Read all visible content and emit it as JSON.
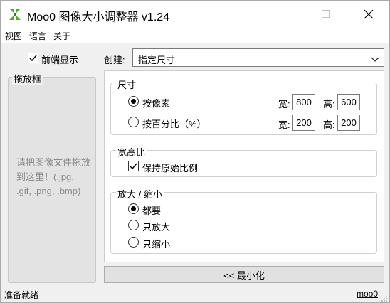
{
  "window": {
    "title": "Moo0 图像大小调整器 v1.24"
  },
  "menu": {
    "items": [
      {
        "label": "视图"
      },
      {
        "label": "语言"
      },
      {
        "label": "关于"
      }
    ]
  },
  "left": {
    "always_on_top_label": "前端显示",
    "always_on_top_checked": true,
    "drop_group_title": "拖放框",
    "drop_text": "请把图像文件拖放到这里！(.jpg, .gif, .png, .bmp)"
  },
  "create": {
    "label": "创建:",
    "selected": "指定尺寸"
  },
  "size_group": {
    "title": "尺寸",
    "by_pixel_label": "按像素",
    "by_pixel_checked": true,
    "by_percent_label": "按百分比（%）",
    "by_percent_checked": false,
    "width_label": "宽:",
    "height_label": "高:",
    "pixel_width": "800",
    "pixel_height": "600",
    "percent_width": "200",
    "percent_height": "200"
  },
  "aspect_group": {
    "title": "宽高比",
    "keep_ratio_label": "保持原始比例",
    "keep_ratio_checked": true
  },
  "scale_group": {
    "title": "放大 / 缩小",
    "options": [
      {
        "label": "都要",
        "checked": true
      },
      {
        "label": "只放大",
        "checked": false
      },
      {
        "label": "只缩小",
        "checked": false
      }
    ]
  },
  "minimize_button": "<< 最小化",
  "status": {
    "text": "准备就绪",
    "link": "moo0"
  },
  "colors": {
    "icon_green": "#4caf2a",
    "icon_dark_green": "#2e7d18"
  }
}
